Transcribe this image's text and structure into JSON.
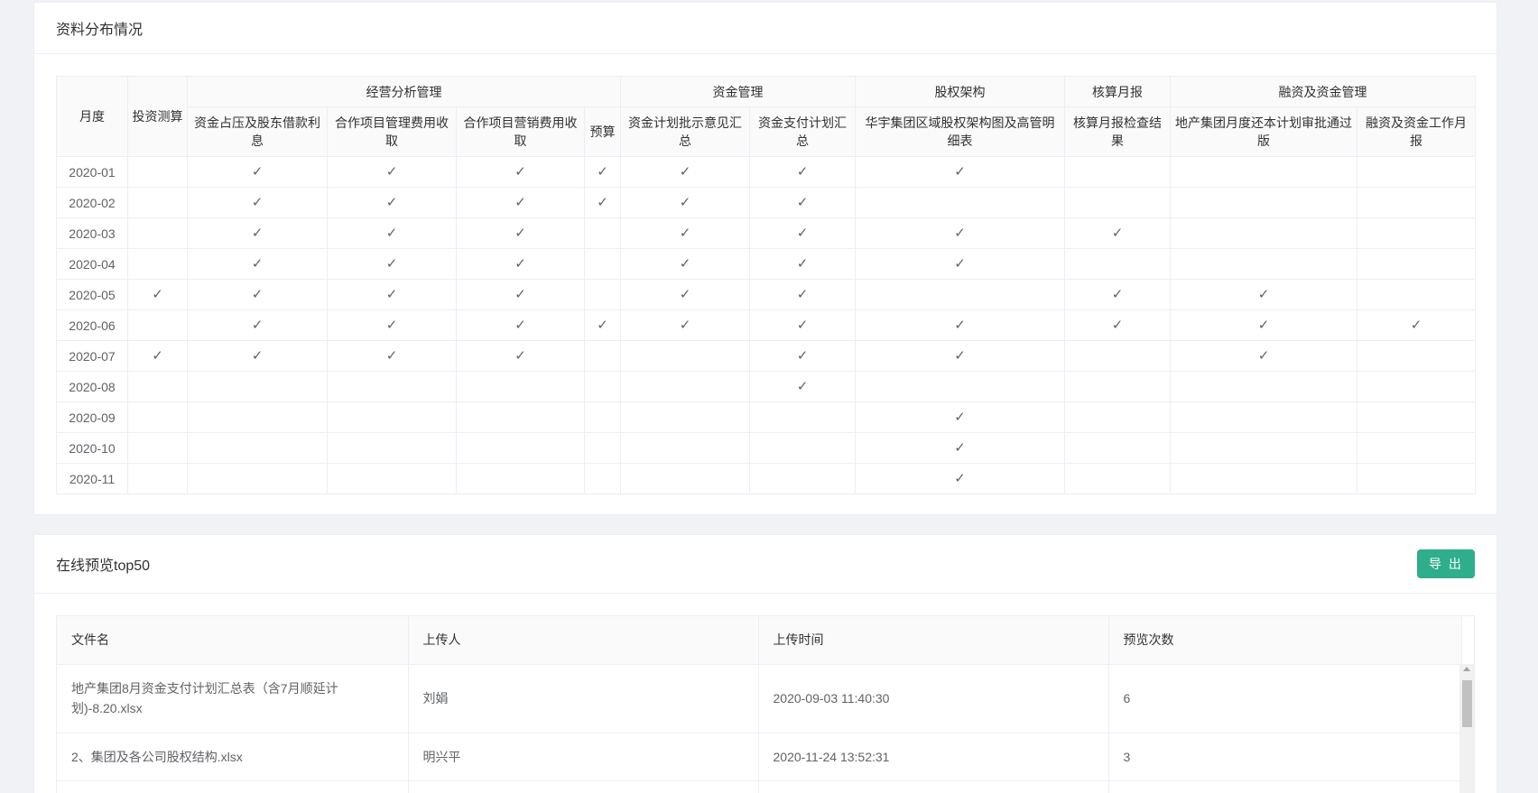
{
  "distribution": {
    "title": "资料分布情况",
    "header_month": "月度",
    "header_invest": "投资测算",
    "groups": [
      "经营分析管理",
      "资金管理",
      "股权架构",
      "核算月报",
      "融资及资金管理"
    ],
    "subheaders": [
      "资金占压及股东借款利息",
      "合作项目管理费用收取",
      "合作项目营销费用收取",
      "预算",
      "资金计划批示意见汇总",
      "资金支付计划汇总",
      "华宇集团区域股权架构图及高管明细表",
      "核算月报检查结果",
      "地产集团月度还本计划审批通过版",
      "融资及资金工作月报"
    ],
    "check_mark": "✓",
    "rows": [
      {
        "month": "2020-01",
        "checks": [
          0,
          1,
          1,
          1,
          1,
          1,
          1,
          1,
          0,
          0,
          0
        ]
      },
      {
        "month": "2020-02",
        "checks": [
          0,
          1,
          1,
          1,
          1,
          1,
          1,
          0,
          0,
          0,
          0
        ]
      },
      {
        "month": "2020-03",
        "checks": [
          0,
          1,
          1,
          1,
          0,
          1,
          1,
          1,
          1,
          0,
          0
        ]
      },
      {
        "month": "2020-04",
        "checks": [
          0,
          1,
          1,
          1,
          0,
          1,
          1,
          1,
          0,
          0,
          0
        ]
      },
      {
        "month": "2020-05",
        "checks": [
          1,
          1,
          1,
          1,
          0,
          1,
          1,
          0,
          1,
          1,
          0
        ]
      },
      {
        "month": "2020-06",
        "checks": [
          0,
          1,
          1,
          1,
          1,
          1,
          1,
          1,
          1,
          1,
          1
        ]
      },
      {
        "month": "2020-07",
        "checks": [
          1,
          1,
          1,
          1,
          0,
          0,
          1,
          1,
          0,
          1,
          0
        ]
      },
      {
        "month": "2020-08",
        "checks": [
          0,
          0,
          0,
          0,
          0,
          0,
          1,
          0,
          0,
          0,
          0
        ]
      },
      {
        "month": "2020-09",
        "checks": [
          0,
          0,
          0,
          0,
          0,
          0,
          0,
          1,
          0,
          0,
          0
        ]
      },
      {
        "month": "2020-10",
        "checks": [
          0,
          0,
          0,
          0,
          0,
          0,
          0,
          1,
          0,
          0,
          0
        ]
      },
      {
        "month": "2020-11",
        "checks": [
          0,
          0,
          0,
          0,
          0,
          0,
          0,
          1,
          0,
          0,
          0
        ]
      }
    ]
  },
  "top50": {
    "title": "在线预览top50",
    "export_label": "导 出",
    "columns": [
      "文件名",
      "上传人",
      "上传时间",
      "预览次数"
    ],
    "rows": [
      {
        "file": "地产集团8月资金支付计划汇总表（含7月顺延计划)-8.20.xlsx",
        "uploader": "刘娟",
        "time": "2020-09-03 11:40:30",
        "count": "6"
      },
      {
        "file": "2、集团及各公司股权结构.xlsx",
        "uploader": "明兴平",
        "time": "2020-11-24 13:52:31",
        "count": "3"
      },
      {
        "file": "",
        "uploader": "",
        "time": "",
        "count": ""
      }
    ]
  }
}
